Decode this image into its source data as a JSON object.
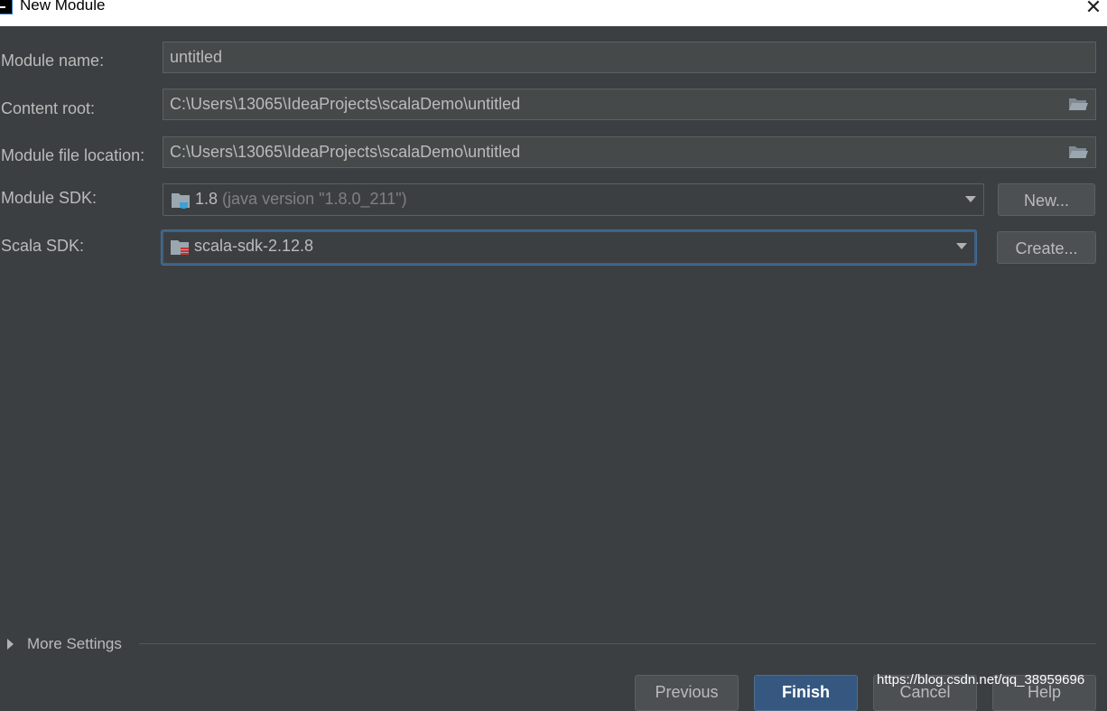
{
  "window": {
    "title": "New Module",
    "close_icon": "close-icon"
  },
  "form": {
    "module_name": {
      "label": "Module name:",
      "value": "untitled"
    },
    "content_root": {
      "label": "Content root:",
      "value": "C:\\Users\\13065\\IdeaProjects\\scalaDemo\\untitled",
      "icon": "folder-open-icon"
    },
    "module_file_location": {
      "label": "Module file location:",
      "value": "C:\\Users\\13065\\IdeaProjects\\scalaDemo\\untitled",
      "icon": "folder-open-icon"
    },
    "module_sdk": {
      "label": "Module SDK:",
      "value": "1.8",
      "detail": "(java version \"1.8.0_211\")",
      "button": "New...",
      "icon": "java-sdk-folder-icon"
    },
    "scala_sdk": {
      "label": "Scala SDK:",
      "value": "scala-sdk-2.12.8",
      "button": "Create...",
      "icon": "scala-sdk-folder-icon"
    }
  },
  "more_settings": {
    "label": "More Settings"
  },
  "buttons": {
    "previous": "Previous",
    "finish": "Finish",
    "cancel": "Cancel",
    "help": "Help"
  },
  "watermark": "https://blog.csdn.net/qq_38959696",
  "colors": {
    "background": "#3c3f41",
    "field_background": "#45494a",
    "focus_border": "#3d6185",
    "default_button": "#365880"
  }
}
